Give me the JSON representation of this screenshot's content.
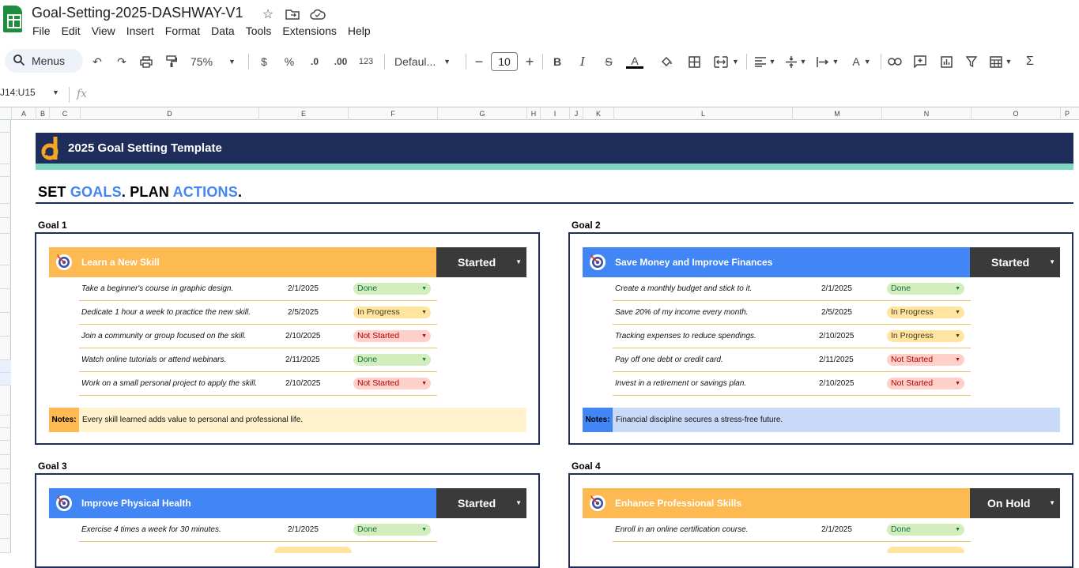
{
  "app": {
    "doc_title": "Goal-Setting-2025-DASHWAY-V1",
    "menus": [
      "File",
      "Edit",
      "View",
      "Insert",
      "Format",
      "Data",
      "Tools",
      "Extensions",
      "Help"
    ]
  },
  "toolbar": {
    "search_label": "Menus",
    "zoom": "75%",
    "currency": "$",
    "percent": "%",
    "dec_decrease": ".0",
    "dec_increase": ".00",
    "number_format": "123",
    "font": "Defaul...",
    "font_size": "10"
  },
  "formula_bar": {
    "namebox": "J14:U15",
    "fx": "fx"
  },
  "columns": [
    "A",
    "B",
    "C",
    "D",
    "E",
    "F",
    "G",
    "H",
    "I",
    "J",
    "K",
    "L",
    "M",
    "N",
    "O",
    "P"
  ],
  "banner": {
    "title": "2025 Goal Setting Template"
  },
  "slogan": {
    "p1": "SET ",
    "p2": "GOALS",
    "p3": ". PLAN ",
    "p4": "ACTIONS",
    "p5": "."
  },
  "notes_label": "Notes:",
  "goals": [
    {
      "label": "Goal 1",
      "title": "Learn a New Skill",
      "status": "Started",
      "tasks": [
        {
          "text": "Take a beginner's course in graphic design.",
          "date": "2/1/2025",
          "state": "Done"
        },
        {
          "text": "Dedicate 1 hour a week to practice the new skill.",
          "date": "2/5/2025",
          "state": "In Progress"
        },
        {
          "text": "Join a community or group focused on the skill.",
          "date": "2/10/2025",
          "state": "Not Started"
        },
        {
          "text": "Watch online tutorials or attend webinars.",
          "date": "2/11/2025",
          "state": "Done"
        },
        {
          "text": "Work on a small personal project to apply the skill.",
          "date": "2/10/2025",
          "state": "Not Started"
        }
      ],
      "notes": "Every skill learned adds value to personal and professional life."
    },
    {
      "label": "Goal 2",
      "title": "Save Money and Improve Finances",
      "status": "Started",
      "tasks": [
        {
          "text": "Create a monthly budget and stick to it.",
          "date": "2/1/2025",
          "state": "Done"
        },
        {
          "text": "Save 20% of my income every month.",
          "date": "2/5/2025",
          "state": "In Progress"
        },
        {
          "text": "Tracking expenses to reduce spendings.",
          "date": "2/10/2025",
          "state": "In Progress"
        },
        {
          "text": "Pay off one debt or credit card.",
          "date": "2/11/2025",
          "state": "Not Started"
        },
        {
          "text": "Invest in a retirement or savings plan.",
          "date": "2/10/2025",
          "state": "Not Started"
        }
      ],
      "notes": "Financial discipline secures a stress-free future."
    },
    {
      "label": "Goal 3",
      "title": "Improve Physical Health",
      "status": "Started",
      "tasks": [
        {
          "text": "Exercise 4 times a week for 30 minutes.",
          "date": "2/1/2025",
          "state": "Done"
        }
      ]
    },
    {
      "label": "Goal 4",
      "title": "Enhance Professional Skills",
      "status": "On Hold",
      "tasks": [
        {
          "text": "Enroll in an online certification course.",
          "date": "2/1/2025",
          "state": "Done"
        }
      ]
    }
  ],
  "colors": {
    "navy": "#1f2d5a",
    "teal": "#7fd6c1",
    "orange": "#fdb952",
    "blue": "#4285f4",
    "notes_orange": "#fff2cc",
    "notes_blue": "#c9daf8",
    "status_dark": "#3a3a3a"
  },
  "icons": [
    "sheets-logo-icon",
    "star-icon",
    "move-folder-icon",
    "cloud-status-icon",
    "search-icon",
    "undo-icon",
    "redo-icon",
    "print-icon",
    "paint-format-icon",
    "target-icon",
    "dashway-logo-icon"
  ]
}
